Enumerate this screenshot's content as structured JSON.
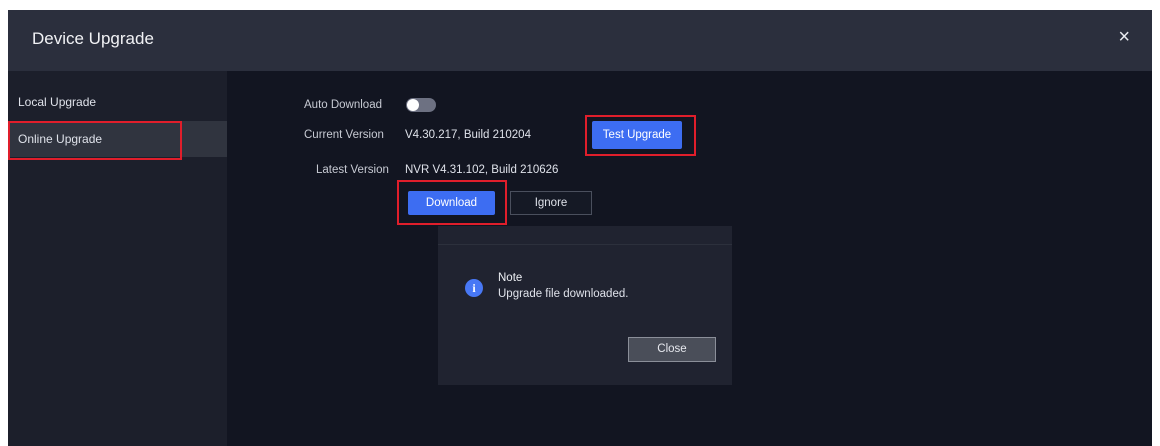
{
  "window": {
    "title": "Device Upgrade",
    "close_glyph": "×"
  },
  "sidebar": {
    "items": [
      {
        "label": "Local Upgrade",
        "active": false
      },
      {
        "label": "Online Upgrade",
        "active": true
      }
    ]
  },
  "online": {
    "auto_download_label": "Auto Download",
    "auto_download_enabled": false,
    "current_version_label": "Current Version",
    "current_version_value": "V4.30.217, Build 210204",
    "test_upgrade_label": "Test Upgrade",
    "latest_version_label": "Latest Version",
    "latest_version_value": "NVR V4.31.102, Build 210626",
    "download_label": "Download",
    "ignore_label": "Ignore"
  },
  "dialog": {
    "icon": "info-icon",
    "icon_glyph": "i",
    "title": "Note",
    "message": "Upgrade file downloaded.",
    "close_label": "Close"
  },
  "colors": {
    "accent": "#3d6df2",
    "highlight_box": "#e01e2b",
    "background": "#121521"
  }
}
